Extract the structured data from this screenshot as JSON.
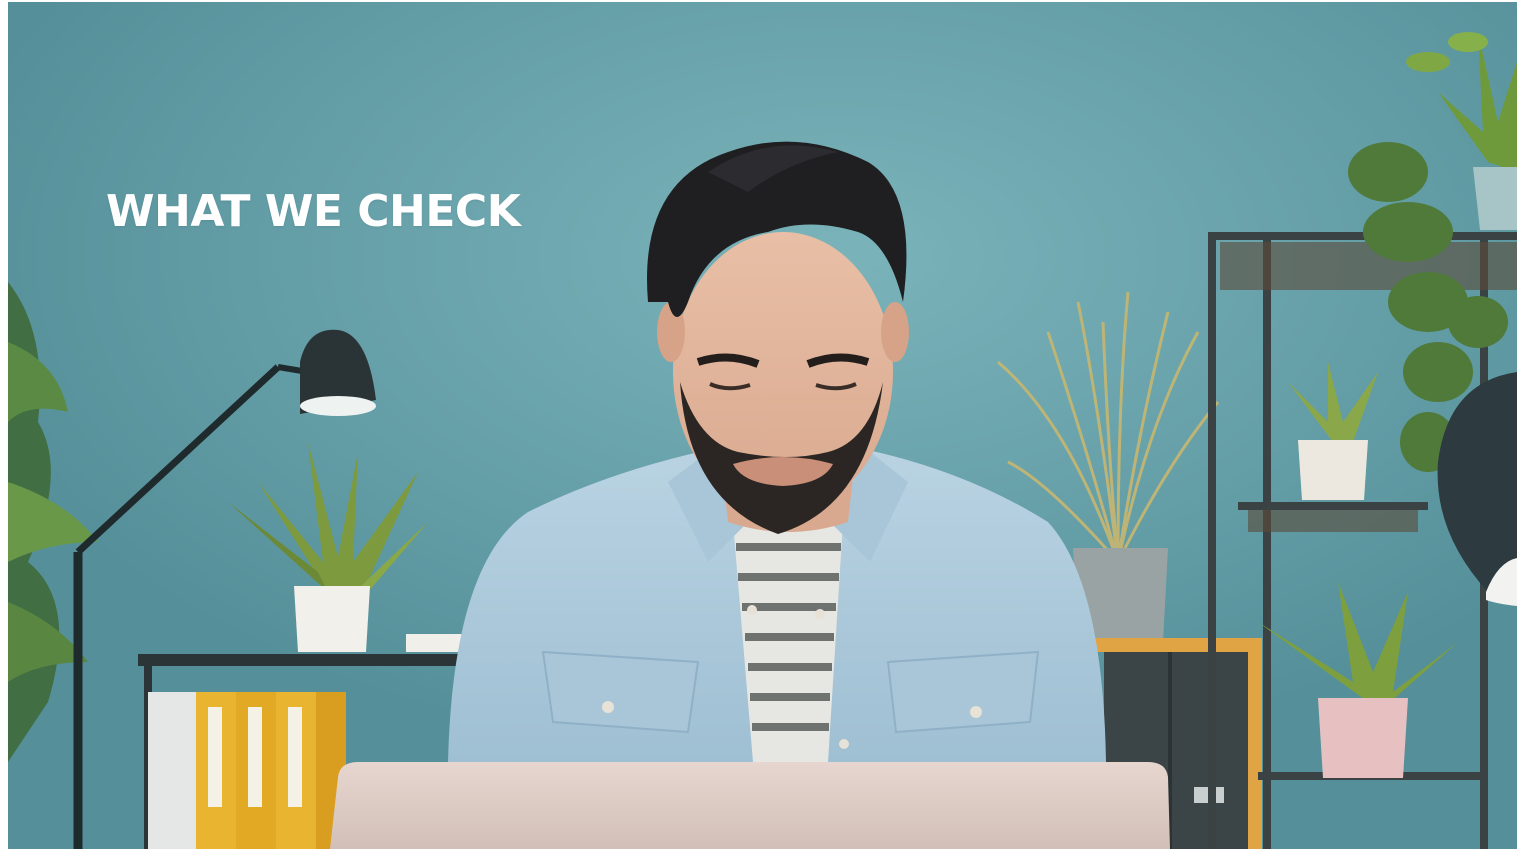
{
  "hero": {
    "title": "WHAT WE CHECK",
    "title_color": "#ffffff",
    "wall_color": "#62a0a8",
    "image_description_icon": "office-photo"
  }
}
